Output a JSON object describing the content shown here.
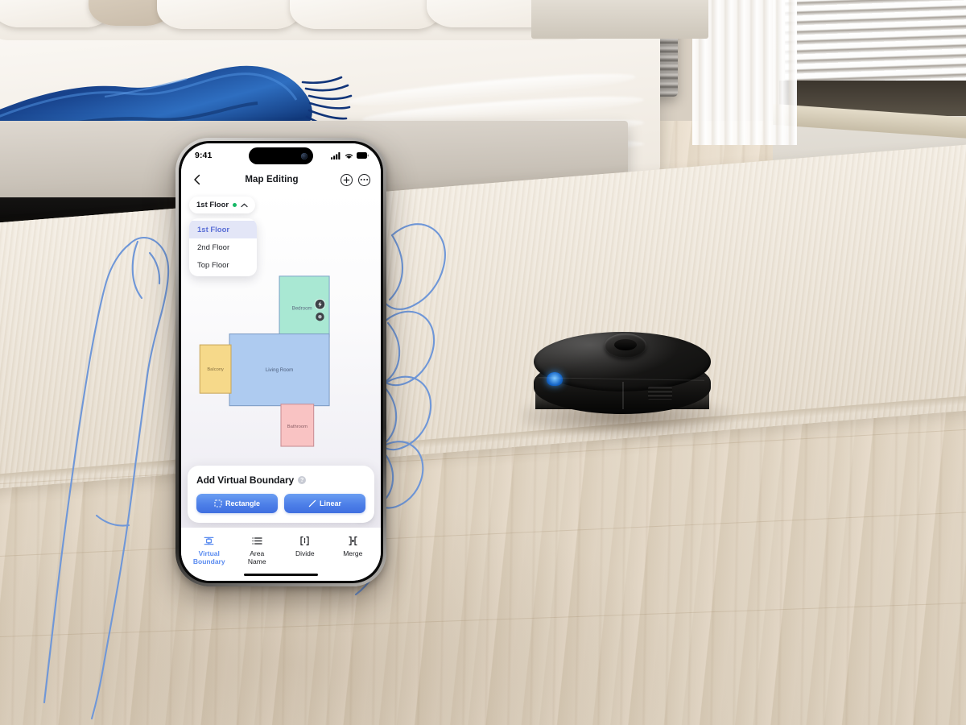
{
  "scene": {
    "description": "Robot vacuum on wood floor in a bedroom, hand line-art holding a smartphone showing the Map Editing screen"
  },
  "phone": {
    "status_bar": {
      "time": "9:41",
      "cellular_icon": "signal-bars-icon",
      "wifi_icon": "wifi-icon",
      "battery_icon": "battery-icon"
    },
    "nav": {
      "back_icon": "chevron-left-icon",
      "title": "Map Editing",
      "add_icon": "plus-circle-icon",
      "more_icon": "more-circle-icon"
    },
    "floor_selector": {
      "selected": "1st Floor",
      "status_dot_color": "#16b866",
      "chevron_icon": "chevron-up-icon",
      "expanded": true,
      "options": [
        {
          "label": "1st Floor",
          "selected": true
        },
        {
          "label": "2nd Floor",
          "selected": false
        },
        {
          "label": "Top Floor",
          "selected": false
        }
      ]
    },
    "map": {
      "fab_icon": "rotate-map-icon",
      "markers": [
        {
          "name": "charging-dock-marker",
          "icon": "lightning-bolt-icon"
        },
        {
          "name": "robot-position-marker",
          "icon": "robot-dot-icon"
        }
      ],
      "rooms": [
        {
          "name": "Bedroom",
          "fill": "#a9e8d3",
          "stroke": "#7fa6c9"
        },
        {
          "name": "Living Room",
          "fill": "#aecbf0",
          "stroke": "#7f9dc4"
        },
        {
          "name": "Balcony",
          "fill": "#f6d98a",
          "stroke": "#c9a85f"
        },
        {
          "name": "Bathroom",
          "fill": "#f9c3c3",
          "stroke": "#c98f96"
        }
      ]
    },
    "action_card": {
      "title": "Add Virtual Boundary",
      "help_icon": "question-mark-icon",
      "help_label": "?",
      "buttons": [
        {
          "label": "Rectangle",
          "icon": "dashed-square-icon"
        },
        {
          "label": "Linear",
          "icon": "diagonal-line-icon"
        }
      ]
    },
    "tab_bar": {
      "active_color": "#5b8cf0",
      "tabs": [
        {
          "label": "Virtual\nBoundary",
          "label_line1": "Virtual",
          "label_line2": "Boundary",
          "icon": "virtual-boundary-icon",
          "active": true
        },
        {
          "label": "Area Name",
          "label_line1": "Area",
          "label_line2": "Name",
          "icon": "list-lines-icon",
          "active": false
        },
        {
          "label": "Divide",
          "label_line1": "Divide",
          "label_line2": "",
          "icon": "divide-brackets-icon",
          "active": false
        },
        {
          "label": "Merge",
          "label_line1": "Merge",
          "label_line2": "",
          "icon": "merge-brackets-icon",
          "active": false
        }
      ]
    }
  }
}
